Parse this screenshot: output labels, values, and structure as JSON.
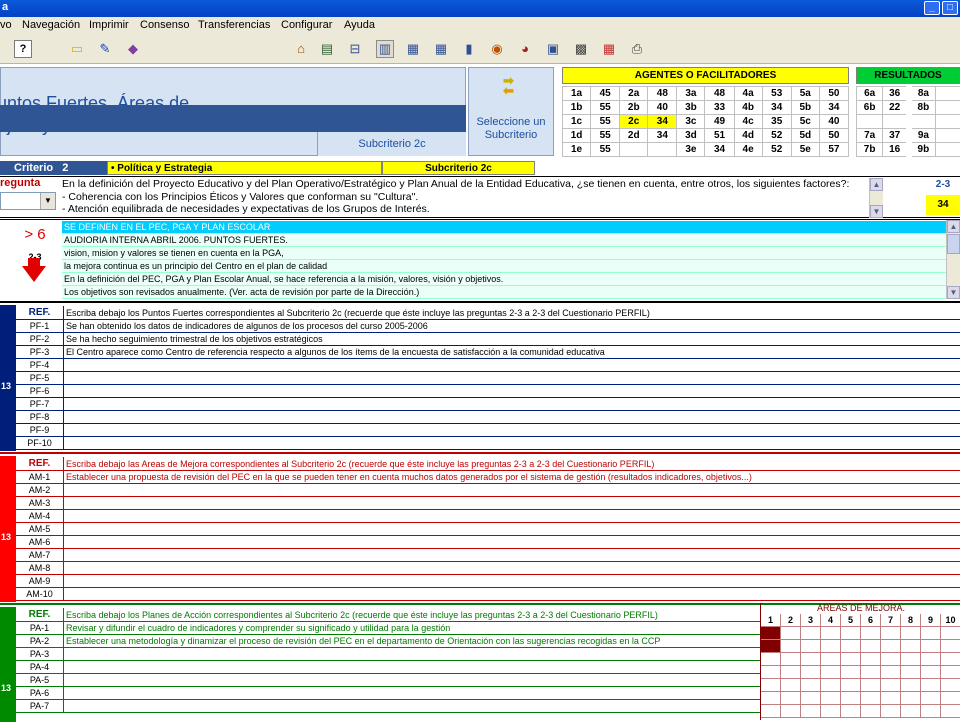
{
  "window": {
    "title": "a",
    "btn_min": "_",
    "btn_max": "□",
    "btn_close": "✕"
  },
  "menu": [
    "vo",
    "Navegación",
    "Imprimir",
    "Consenso",
    "Transferencias",
    "Configurar",
    "Ayuda"
  ],
  "header": {
    "title_line1": "untos Fuertes, Áreas de",
    "title_line2": "ejora y Planes de Acción",
    "subcriterio_box": "Subcriterio 2c",
    "select_label_1": "Seleccione un",
    "select_label_2": "Subcriterio",
    "select_arrows": "⇨ ⇦"
  },
  "agentes": {
    "title": "AGENTES O FACILITADORES",
    "rows": [
      [
        "1a",
        "45",
        "2a",
        "48",
        "3a",
        "48",
        "4a",
        "53",
        "5a",
        "50"
      ],
      [
        "1b",
        "55",
        "2b",
        "40",
        "3b",
        "33",
        "4b",
        "34",
        "5b",
        "34"
      ],
      [
        "1c",
        "55",
        "2c",
        "34",
        "3c",
        "49",
        "4c",
        "35",
        "5c",
        "40"
      ],
      [
        "1d",
        "55",
        "2d",
        "34",
        "3d",
        "51",
        "4d",
        "52",
        "5d",
        "50"
      ],
      [
        "1e",
        "55",
        "",
        "",
        "3e",
        "34",
        "4e",
        "52",
        "5e",
        "57"
      ]
    ],
    "highlight": "2c"
  },
  "resultados": {
    "title": "RESULTADOS",
    "rows": [
      [
        "6a",
        "36",
        "8a",
        ""
      ],
      [
        "6b",
        "22",
        "8b",
        ""
      ],
      [
        "",
        "",
        "",
        ""
      ],
      [
        "7a",
        "37",
        "9a",
        ""
      ],
      [
        "7b",
        "16",
        "9b",
        ""
      ]
    ]
  },
  "critbar": {
    "criterio_label": "Criterio",
    "criterio_num": "2",
    "criterio_name": "• Política y Estrategia",
    "subcriterio": "Subcriterio 2c"
  },
  "question": {
    "left_label": "regunta",
    "text_1": "En la definición del Proyecto Educativo y del  Plan Operativo/Estratégico y Plan Anual de la Entidad Educativa, ¿se tienen en cuenta, entre otros, los siguientes factores?:",
    "text_2": "  - Coherencia con los Principios Éticos y Valores que conforman su \"Cultura\".",
    "text_3": "  - Atención equilibrada de necesidades y expectativas de los Grupos de Interés.",
    "code": "2-3",
    "score": "34"
  },
  "answers": {
    "score_label": "> 6",
    "code": "2-3",
    "lines": [
      "SE DEFINEN EN EL PEC, PGA Y PLAN ESCOLAR",
      "AUDIORIA INTERNA ABRIL 2006. PUNTOS FUERTES.",
      "vision, mision y valores se tienen en cuenta en la PGA,",
      "la mejora continua es un principio del Centro en el plan de calidad",
      "En la definición del PEC,  PGA y Plan Escolar Anual, se hace referencia a la  misión, valores, visión y objetivos.",
      "Los objetivos son revisados anualmente. (Ver. acta de revisión por parte de la Dirección.)"
    ]
  },
  "pf": {
    "ref_label": "REF.",
    "header": "Escriba debajo los Puntos Fuertes correspondientes al Subcriterio 2c (recuerde que éste incluye las preguntas 2-3 a 2-3 del Cuestionario PERFIL)",
    "side": "13",
    "rows": [
      [
        "PF-1",
        "Se han obtenido los datos de indicadores de algunos de los procesos del curso 2005-2006"
      ],
      [
        "PF-2",
        "Se ha hecho seguimiento trimestral de los objetivos estratégicos"
      ],
      [
        "PF-3",
        "El Centro aparece como Centro de referencia respecto a algunos de los ítems de la encuesta de satisfacción a la comunidad educativa"
      ],
      [
        "PF-4",
        ""
      ],
      [
        "PF-5",
        ""
      ],
      [
        "PF-6",
        ""
      ],
      [
        "PF-7",
        ""
      ],
      [
        "PF-8",
        ""
      ],
      [
        "PF-9",
        ""
      ],
      [
        "PF-10",
        ""
      ]
    ]
  },
  "am": {
    "ref_label": "REF.",
    "header": "Escriba debajo las Areas de Mejora correspondientes al Subcriterio 2c (recuerde que éste incluye las preguntas 2-3 a 2-3 del Cuestionario PERFIL)",
    "side": "13",
    "rows": [
      [
        "AM-1",
        "Establecer una propuesta de revisión del PEC en la que se pueden tener en cuenta muchos datos generados por el sistema de gestión (resultados indicadores, objetivos...)"
      ],
      [
        "AM-2",
        ""
      ],
      [
        "AM-3",
        ""
      ],
      [
        "AM-4",
        ""
      ],
      [
        "AM-5",
        ""
      ],
      [
        "AM-6",
        ""
      ],
      [
        "AM-7",
        ""
      ],
      [
        "AM-8",
        ""
      ],
      [
        "AM-9",
        ""
      ],
      [
        "AM-10",
        ""
      ]
    ]
  },
  "pa": {
    "ref_label": "REF.",
    "header": "Escriba debajo los Planes de Acción correspondientes al Subcriterio 2c (recuerde que éste incluye las preguntas 2-3 a 2-3 del Cuestionario PERFIL)",
    "side": "13",
    "rows": [
      [
        "PA-1",
        "Revisar y difundir el cuadro de indicadores y comprender su significado y utilidad para la gestión"
      ],
      [
        "PA-2",
        "Establecer una metodología y dinamizar el proceso de revisión del PEC en el departamento de Orientación con las sugerencias recogidas en la CCP"
      ],
      [
        "PA-3",
        ""
      ],
      [
        "PA-4",
        ""
      ],
      [
        "PA-5",
        ""
      ],
      [
        "PA-6",
        ""
      ],
      [
        "PA-7",
        ""
      ]
    ],
    "grid_title": "AREAS DE MEJORA.",
    "grid_cols": [
      "1",
      "2",
      "3",
      "4",
      "5",
      "6",
      "7",
      "8",
      "9",
      "10"
    ],
    "filled": [
      [
        0,
        0
      ],
      [
        1,
        0
      ]
    ]
  }
}
